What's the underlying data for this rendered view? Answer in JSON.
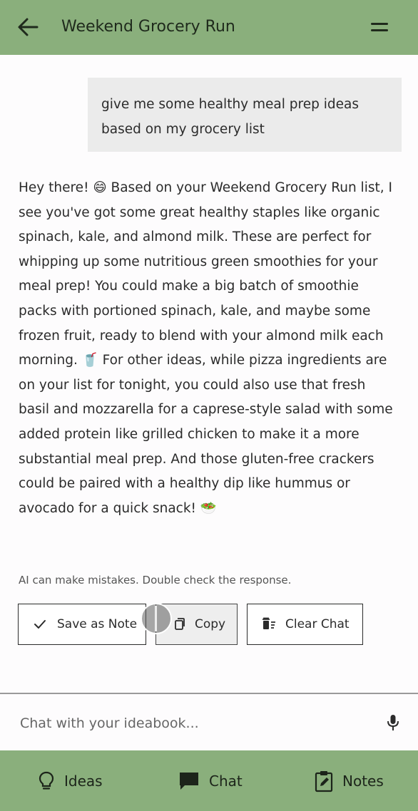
{
  "header": {
    "title": "Weekend Grocery Run",
    "back_icon": "arrow-left-icon",
    "menu_icon": "hamburger-menu-icon"
  },
  "conversation": {
    "user_message": "give me some healthy meal prep ideas based on my grocery list",
    "ai_message": "Hey there! 😄 Based on your Weekend Grocery Run list, I see you've got some great healthy staples like organic spinach, kale, and almond milk. These are perfect for whipping up some nutritious green smoothies for your meal prep! You could make a big batch of smoothie packs with portioned spinach, kale, and maybe some frozen fruit, ready to blend with your almond milk each morning. 🥤 For other ideas, while pizza ingredients are on your list for tonight, you could also use that fresh basil and mozzarella for a caprese-style salad with some added protein like grilled chicken to make it a more substantial meal prep. And those gluten-free crackers could be paired with a healthy dip like hummus or avocado for a quick snack! 🥗",
    "disclaimer": "AI can make mistakes. Double check the response."
  },
  "actions": {
    "save_label": "Save as Note",
    "copy_label": "Copy",
    "clear_label": "Clear Chat"
  },
  "input": {
    "placeholder": "Chat with your ideabook..."
  },
  "nav": {
    "ideas": "Ideas",
    "chat": "Chat",
    "notes": "Notes"
  },
  "colors": {
    "accent": "#8aaf7c",
    "bubble": "#ebebeb",
    "text": "#2b2b2b"
  }
}
